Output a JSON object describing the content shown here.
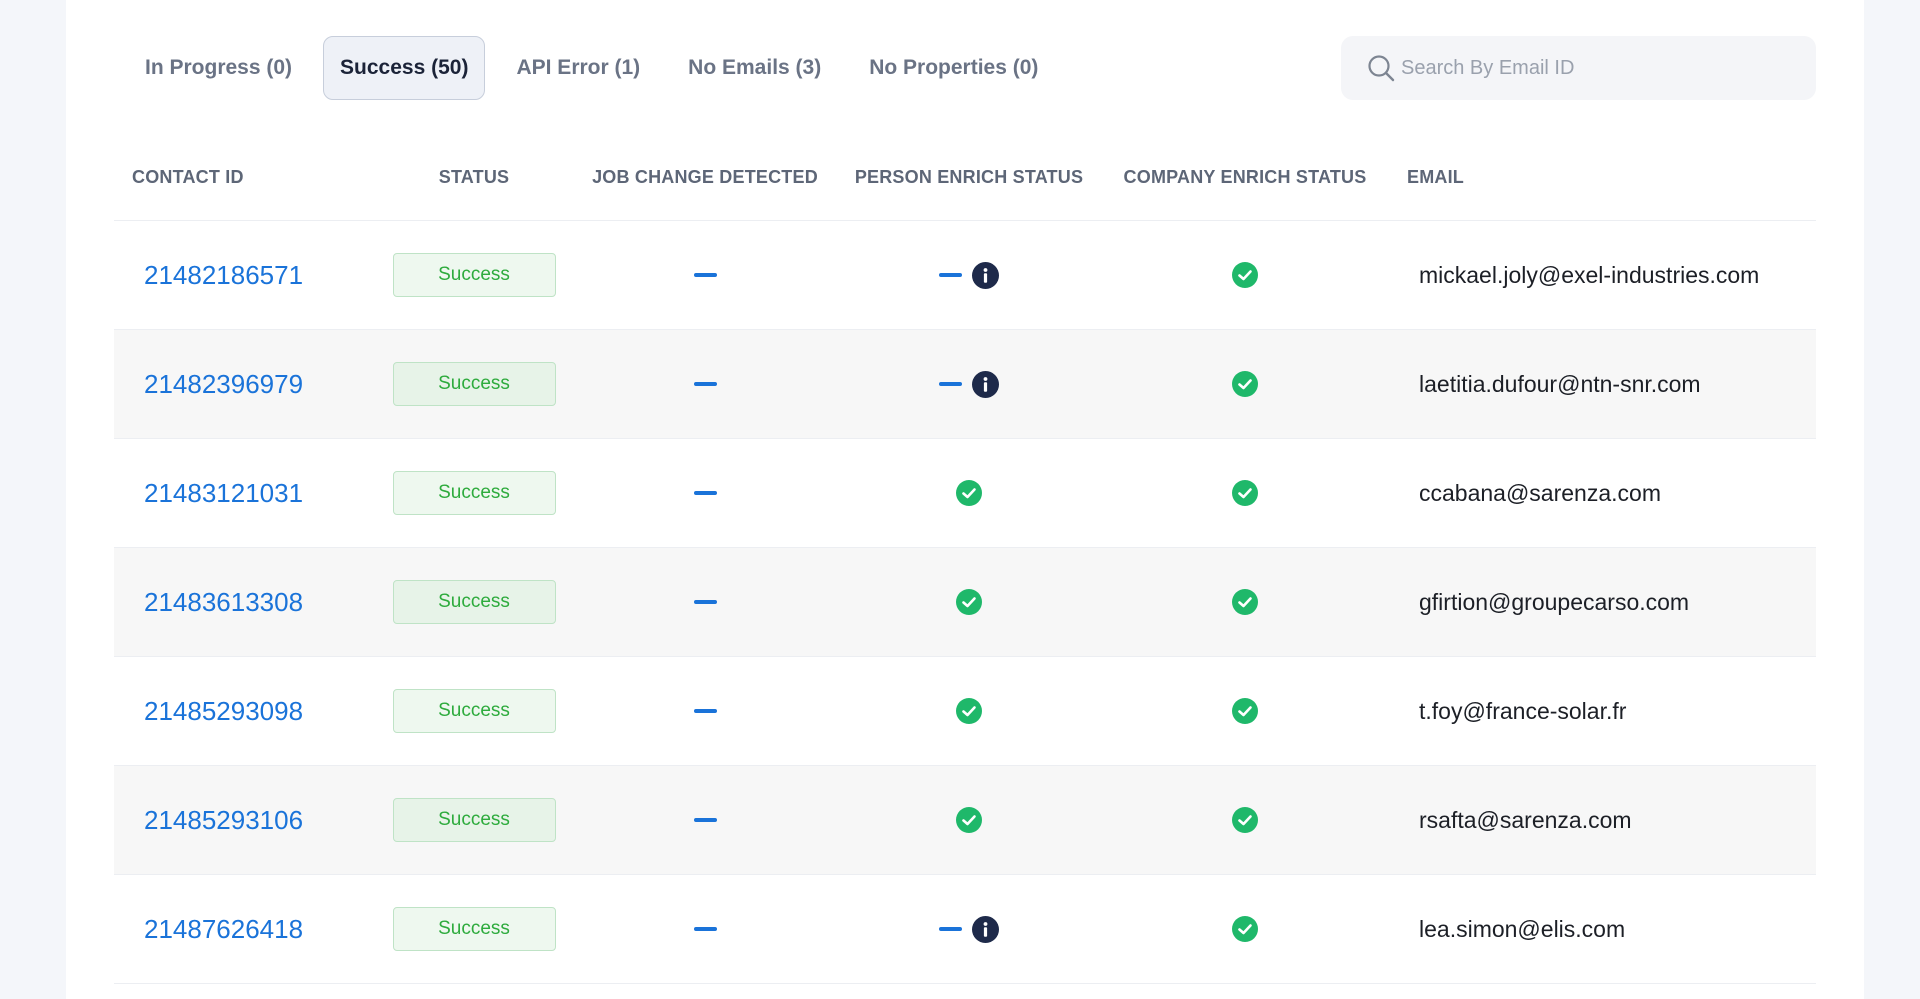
{
  "tabs": [
    {
      "label": "In Progress (0)",
      "active": false
    },
    {
      "label": "Success (50)",
      "active": true
    },
    {
      "label": "API Error (1)",
      "active": false
    },
    {
      "label": "No Emails (3)",
      "active": false
    },
    {
      "label": "No Properties (0)",
      "active": false
    }
  ],
  "search": {
    "placeholder": "Search By Email ID",
    "icon": "search-icon"
  },
  "table": {
    "headers": {
      "contact_id": "CONTACT ID",
      "status": "STATUS",
      "job_change": "JOB CHANGE DETECTED",
      "person_enrich": "PERSON ENRICH STATUS",
      "company_enrich": "COMPANY ENRICH STATUS",
      "email": "EMAIL"
    },
    "rows": [
      {
        "contact_id": "21482186571",
        "status": "Success",
        "job_change": "dash",
        "person_enrich": "dash-info",
        "company_enrich": "check",
        "email": "mickael.joly@exel-industries.com"
      },
      {
        "contact_id": "21482396979",
        "status": "Success",
        "job_change": "dash",
        "person_enrich": "dash-info",
        "company_enrich": "check",
        "email": "laetitia.dufour@ntn-snr.com"
      },
      {
        "contact_id": "21483121031",
        "status": "Success",
        "job_change": "dash",
        "person_enrich": "check",
        "company_enrich": "check",
        "email": "ccabana@sarenza.com"
      },
      {
        "contact_id": "21483613308",
        "status": "Success",
        "job_change": "dash",
        "person_enrich": "check",
        "company_enrich": "check",
        "email": "gfirtion@groupecarso.com"
      },
      {
        "contact_id": "21485293098",
        "status": "Success",
        "job_change": "dash",
        "person_enrich": "check",
        "company_enrich": "check",
        "email": "t.foy@france-solar.fr"
      },
      {
        "contact_id": "21485293106",
        "status": "Success",
        "job_change": "dash",
        "person_enrich": "check",
        "company_enrich": "check",
        "email": "rsafta@sarenza.com"
      },
      {
        "contact_id": "21487626418",
        "status": "Success",
        "job_change": "dash",
        "person_enrich": "dash-info",
        "company_enrich": "check",
        "email": "lea.simon@elis.com"
      }
    ]
  },
  "colors": {
    "link": "#1a73d9",
    "success_text": "#2eab3d",
    "success_bg": "#eef8ef",
    "check_green": "#1fb86a",
    "info_navy": "#1e2a4a"
  }
}
